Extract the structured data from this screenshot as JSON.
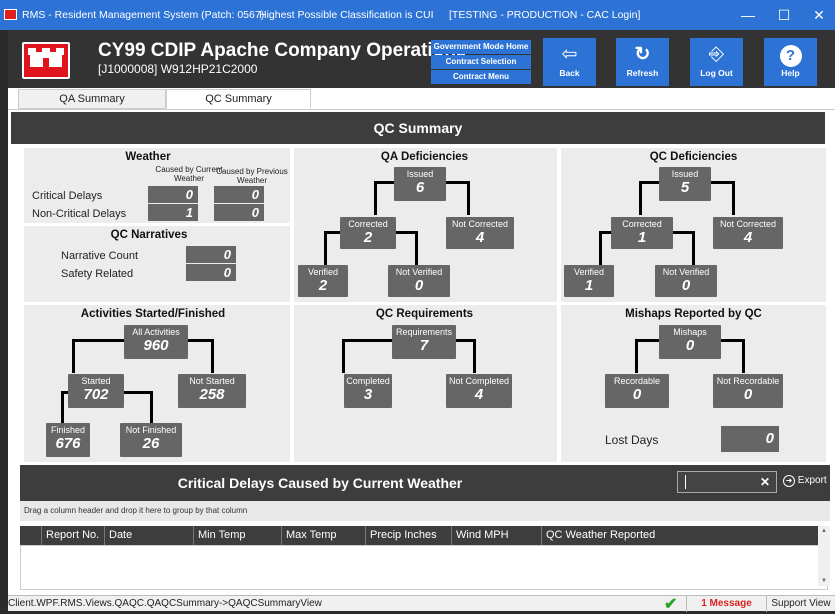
{
  "window": {
    "app": "RMS - Resident Management System (Patch: 0567)",
    "classification": "Highest Possible Classification is CUI",
    "environment": "[TESTING - PRODUCTION - CAC Login]",
    "minimize": "—",
    "maximize": "☐",
    "close": "✕"
  },
  "header": {
    "title": "CY99 CDIP Apache Company Operations",
    "subtitle": "[J1000008] W912HP21C2000",
    "links": [
      "Government Mode Home",
      "Contract Selection",
      "Contract Menu"
    ],
    "buttons": [
      {
        "label": "Back",
        "icon": "back-arrow-icon",
        "glyph": "⇦"
      },
      {
        "label": "Refresh",
        "icon": "refresh-icon",
        "glyph": "↻"
      },
      {
        "label": "Log Out",
        "icon": "logout-icon",
        "glyph": "⎆"
      },
      {
        "label": "Help",
        "icon": "help-icon",
        "glyph": "?"
      }
    ]
  },
  "tabs": [
    {
      "label": "QA Summary",
      "active": false
    },
    {
      "label": "QC Summary",
      "active": true
    }
  ],
  "banner": "QC Summary",
  "weather": {
    "title": "Weather",
    "col1": "Caused by Current Weather",
    "col2": "Caused by Previous Weather",
    "rows": [
      {
        "label": "Critical Delays",
        "current": "0",
        "previous": "0"
      },
      {
        "label": "Non-Critical Delays",
        "current": "1",
        "previous": "0"
      }
    ]
  },
  "narratives": {
    "title": "QC Narratives",
    "rows": [
      {
        "label": "Narrative Count",
        "value": "0"
      },
      {
        "label": "Safety Related",
        "value": "0"
      }
    ]
  },
  "qa_deficiencies": {
    "title": "QA Deficiencies",
    "issued": {
      "label": "Issued",
      "value": "6"
    },
    "corrected": {
      "label": "Corrected",
      "value": "2"
    },
    "not_corrected": {
      "label": "Not Corrected",
      "value": "4"
    },
    "verified": {
      "label": "Verified",
      "value": "2"
    },
    "not_verified": {
      "label": "Not Verified",
      "value": "0"
    }
  },
  "qc_deficiencies": {
    "title": "QC Deficiencies",
    "issued": {
      "label": "Issued",
      "value": "5"
    },
    "corrected": {
      "label": "Corrected",
      "value": "1"
    },
    "not_corrected": {
      "label": "Not Corrected",
      "value": "4"
    },
    "verified": {
      "label": "Verified",
      "value": "1"
    },
    "not_verified": {
      "label": "Not Verified",
      "value": "0"
    }
  },
  "activities": {
    "title": "Activities Started/Finished",
    "all": {
      "label": "All Activities",
      "value": "960"
    },
    "started": {
      "label": "Started",
      "value": "702"
    },
    "not_started": {
      "label": "Not Started",
      "value": "258"
    },
    "finished": {
      "label": "Finished",
      "value": "676"
    },
    "not_finished": {
      "label": "Not Finished",
      "value": "26"
    }
  },
  "requirements": {
    "title": "QC Requirements",
    "total": {
      "label": "Requirements",
      "value": "7"
    },
    "completed": {
      "label": "Completed",
      "value": "3"
    },
    "not_completed": {
      "label": "Not Completed",
      "value": "4"
    }
  },
  "mishaps": {
    "title": "Mishaps Reported by QC",
    "total": {
      "label": "Mishaps",
      "value": "0"
    },
    "recordable": {
      "label": "Recordable",
      "value": "0"
    },
    "not_recordable": {
      "label": "Not Recordable",
      "value": "0"
    },
    "lost_days_label": "Lost Days",
    "lost_days": "0"
  },
  "grid": {
    "title": "Critical Delays Caused by Current Weather",
    "search_value": "",
    "export_label": "Export",
    "drag_hint": "Drag a column header and drop it here to group by that column",
    "columns": [
      "Report No.",
      "Date",
      "Min Temp",
      "Max Temp",
      "Precip Inches",
      "Wind MPH",
      "QC Weather Reported"
    ]
  },
  "status": {
    "path": "Client.WPF.RMS.Views.QAQC.QAQCSummary->QAQCSummaryView",
    "message": "1 Message",
    "support": "Support View"
  }
}
